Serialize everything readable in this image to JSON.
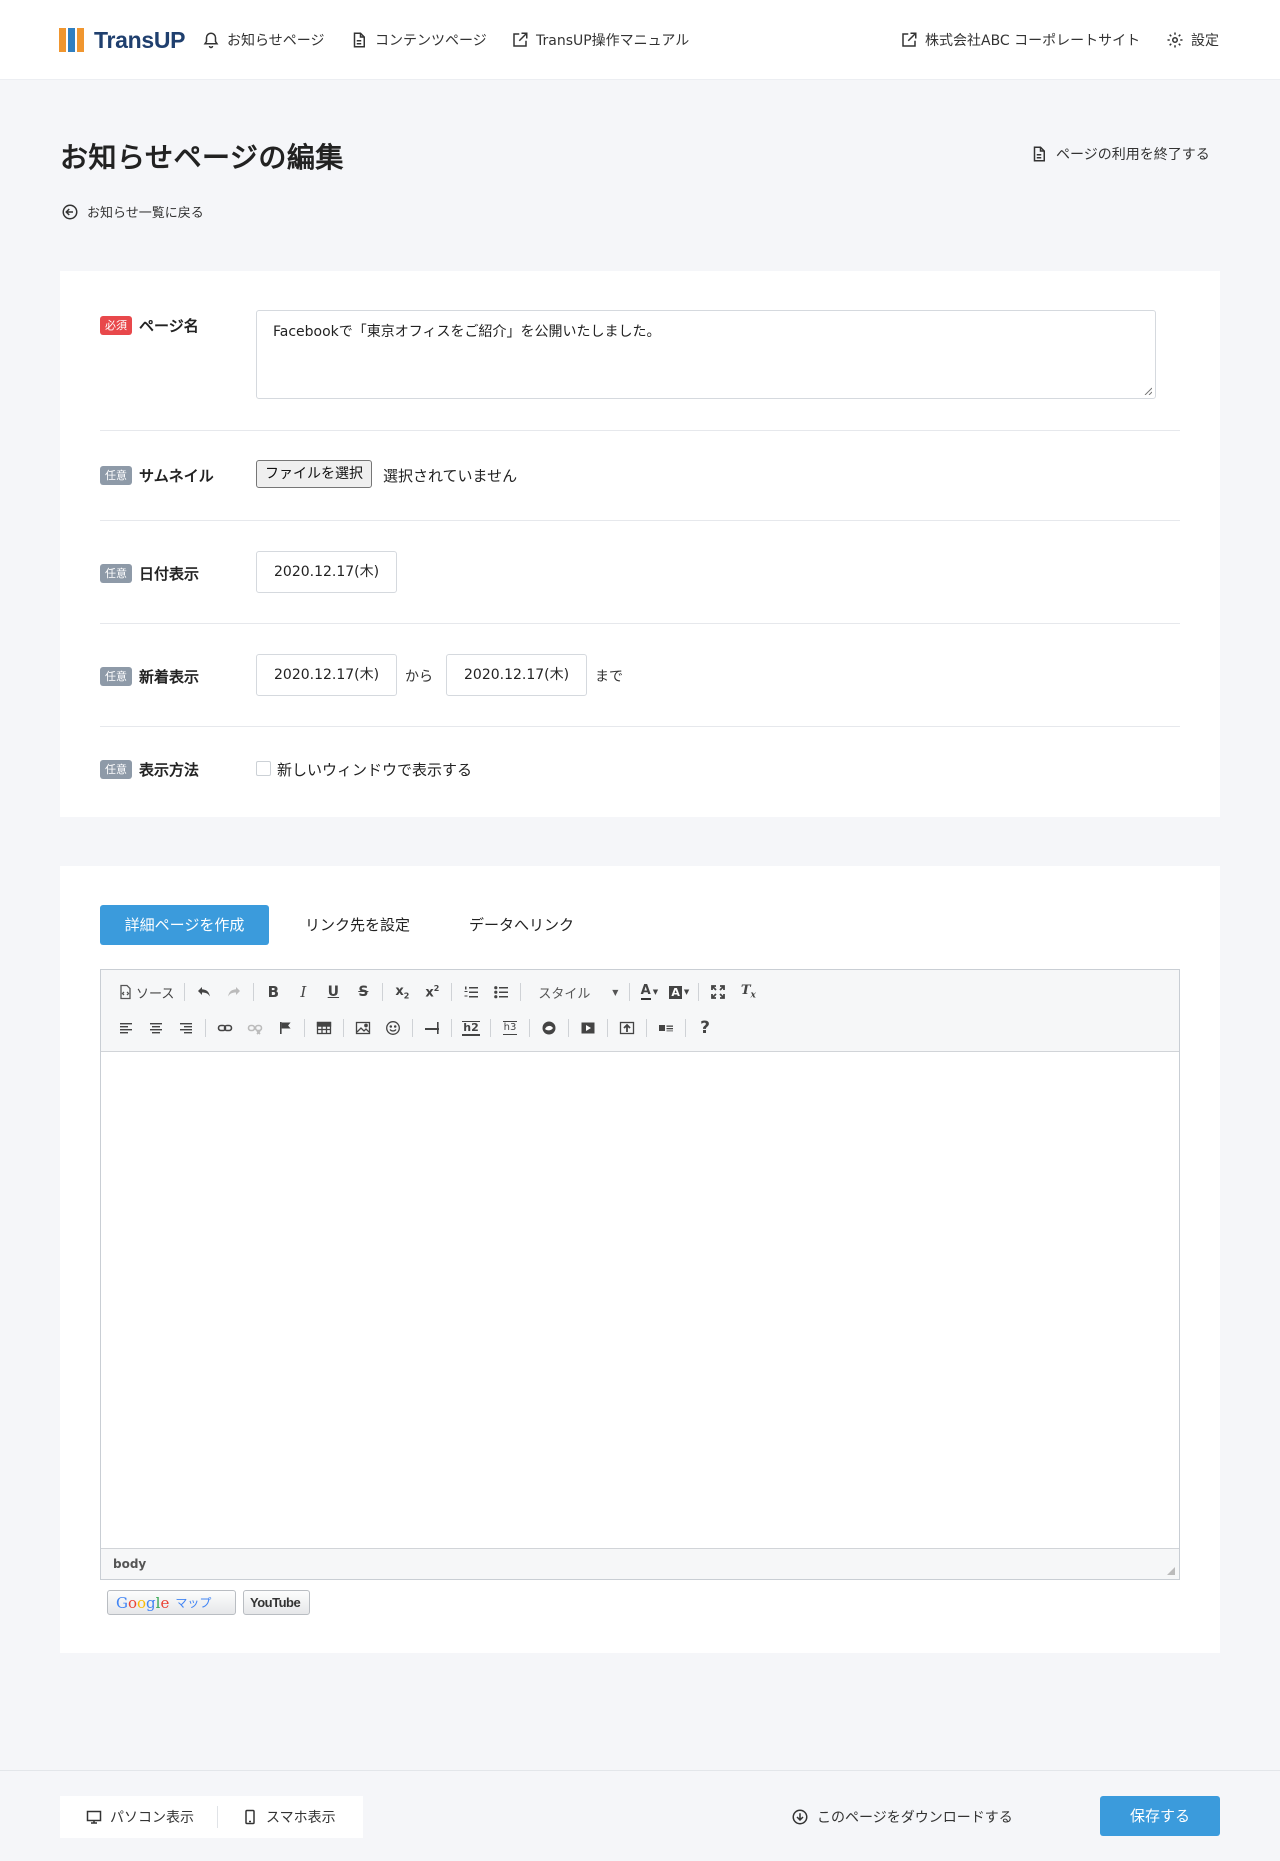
{
  "header": {
    "logo": "TransUP",
    "nav_notice": "お知らせページ",
    "nav_contents": "コンテンツページ",
    "nav_manual": "TransUP操作マニュアル",
    "nav_corporate": "株式会社ABC コーポレートサイト",
    "nav_settings": "設定"
  },
  "page": {
    "title": "お知らせページの編集",
    "end_use": "ページの利用を終了する",
    "back": "お知らせ一覧に戻る"
  },
  "form": {
    "badge_required": "必須",
    "badge_optional": "任意",
    "page_name": {
      "label": "ページ名",
      "value": "Facebookで「東京オフィスをご紹介」を公開いたしました。"
    },
    "thumbnail": {
      "label": "サムネイル",
      "button": "ファイルを選択",
      "status": "選択されていません"
    },
    "date_display": {
      "label": "日付表示",
      "value": "2020.12.17(木)"
    },
    "new_display": {
      "label": "新着表示",
      "from": "2020.12.17(木)",
      "from_text": "から",
      "to": "2020.12.17(木)",
      "to_text": "まで"
    },
    "display_method": {
      "label": "表示方法",
      "option": "新しいウィンドウで表示する",
      "checked": false
    }
  },
  "tabs": [
    "詳細ページを作成",
    "リンク先を設定",
    "データへリンク"
  ],
  "editor": {
    "source_label": "ソース",
    "style_label": "スタイル",
    "path": "body"
  },
  "plugins": {
    "google_maps": "マップ",
    "youtube": "YouTube"
  },
  "footer": {
    "pc_view": "パソコン表示",
    "sp_view": "スマホ表示",
    "download": "このページをダウンロードする",
    "save": "保存する"
  },
  "colors": {
    "primary": "#3b9bdc",
    "required": "#e8484b",
    "optional": "#8e9aa8",
    "logo_navy": "#1f3f6e",
    "logo_orange": "#f0962f",
    "logo_blue": "#2f7fc1"
  }
}
